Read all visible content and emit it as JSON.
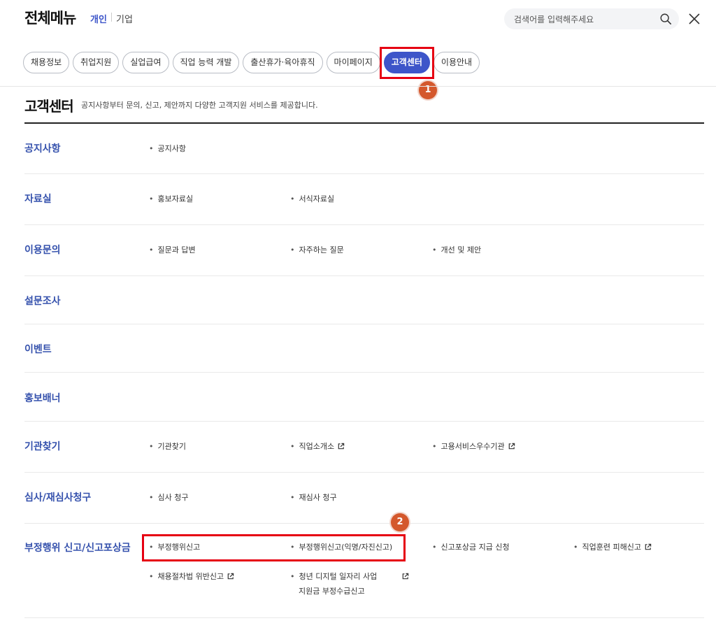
{
  "header": {
    "title": "전체메뉴",
    "tab_personal": "개인",
    "tab_company": "기업",
    "search_placeholder": "검색어를 입력해주세요"
  },
  "chips": [
    {
      "label": "채용정보"
    },
    {
      "label": "취업지원"
    },
    {
      "label": "실업급여"
    },
    {
      "label": "직업 능력 개발"
    },
    {
      "label": "출산휴가·육아휴직"
    },
    {
      "label": "마이페이지"
    },
    {
      "label": "고객센터"
    },
    {
      "label": "이용안내"
    }
  ],
  "badges": {
    "one": "1",
    "two": "2"
  },
  "section": {
    "title": "고객센터",
    "desc": "공지사항부터 문의, 신고, 제안까지 다양한 고객지원 서비스를 제공합니다."
  },
  "rows": [
    {
      "title": "공지사항",
      "items": [
        "공지사항"
      ]
    },
    {
      "title": "자료실",
      "items": [
        "홍보자료실",
        "서식자료실"
      ]
    },
    {
      "title": "이용문의",
      "items": [
        "질문과 답변",
        "자주하는 질문",
        "개선 및 제안"
      ]
    },
    {
      "title": "설문조사",
      "items": []
    },
    {
      "title": "이벤트",
      "items": []
    },
    {
      "title": "홍보배너",
      "items": []
    },
    {
      "title": "기관찾기",
      "items": [
        "기관찾기",
        "직업소개소",
        "고용서비스우수기관"
      ]
    },
    {
      "title": "심사/재심사청구",
      "items": [
        "심사 청구",
        "재심사 청구"
      ]
    },
    {
      "title": "부정행위 신고/신고포상금",
      "items": [
        "부정행위신고",
        "부정행위신고(익명/자진신고)",
        "신고포상금 지급 신청",
        "직업훈련 피해신고",
        "채용절차법 위반신고",
        "청년 디지털 일자리 사업",
        "지원금 부정수급신고"
      ]
    }
  ],
  "colors": {
    "accent": "#3d55c9",
    "highlight": "#e60012",
    "badge": "#d4582c",
    "row_title": "#3652ad"
  }
}
